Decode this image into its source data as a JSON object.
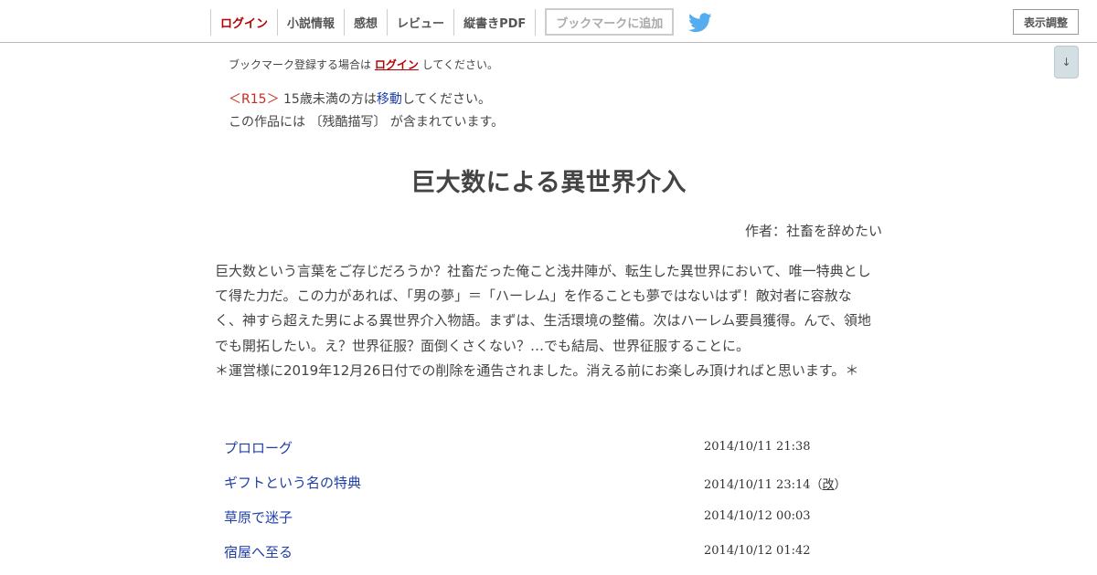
{
  "header": {
    "nav": [
      {
        "label": "ログイン"
      },
      {
        "label": "小説情報"
      },
      {
        "label": "感想"
      },
      {
        "label": "レビュー"
      },
      {
        "label": "縦書きPDF"
      }
    ],
    "bookmark_button": "ブックマークに追加",
    "display_adjust": "表示調整"
  },
  "scroll_button": "↓",
  "bookmark_note": {
    "before": "ブックマーク登録する場合は",
    "link": "ログイン",
    "after": "してください。"
  },
  "rating": {
    "tag": "＜R15＞",
    "text_before": "15歳未満の方は",
    "link": "移動",
    "text_after": "してください。"
  },
  "content_warning": "この作品には 〔残酷描写〕 が含まれています。",
  "novel": {
    "title": "巨大数による異世界介入",
    "author_label": "作者：",
    "author_name": "社畜を辞めたい",
    "synopsis": [
      "巨大数という言葉をご存じだろうか？社畜だった俺こと浅井陣が、転生した異世界において、唯一特典とし",
      "て得た力だ。この力があれば、「男の夢」＝「ハーレム」を作ることも夢ではないはず！敵対者に容赦な",
      "く、神すら超えた男による異世界介入物語。まずは、生活環境の整備。次はハーレム要員獲得。んで、領地",
      "でも開拓したい。え？世界征服？面倒くさくない？…でも結局、世界征服することに。",
      "＊運営様に2019年12月26日付での削除を通告されました。消える前にお楽しみ頂ければと思います。＊"
    ]
  },
  "chapters": [
    {
      "title": "プロローグ",
      "date": "2014/10/11 21:38",
      "revised": ""
    },
    {
      "title": "ギフトという名の特典",
      "date": "2014/10/11 23:14",
      "revised": "改"
    },
    {
      "title": "草原で迷子",
      "date": "2014/10/12 00:03",
      "revised": ""
    },
    {
      "title": "宿屋へ至る",
      "date": "2014/10/12 01:42",
      "revised": ""
    }
  ],
  "colors": {
    "login_red": "#b60000",
    "link_blue": "#1f3fa7",
    "r15_red": "#c82a20",
    "twitter_blue": "#55acee"
  }
}
